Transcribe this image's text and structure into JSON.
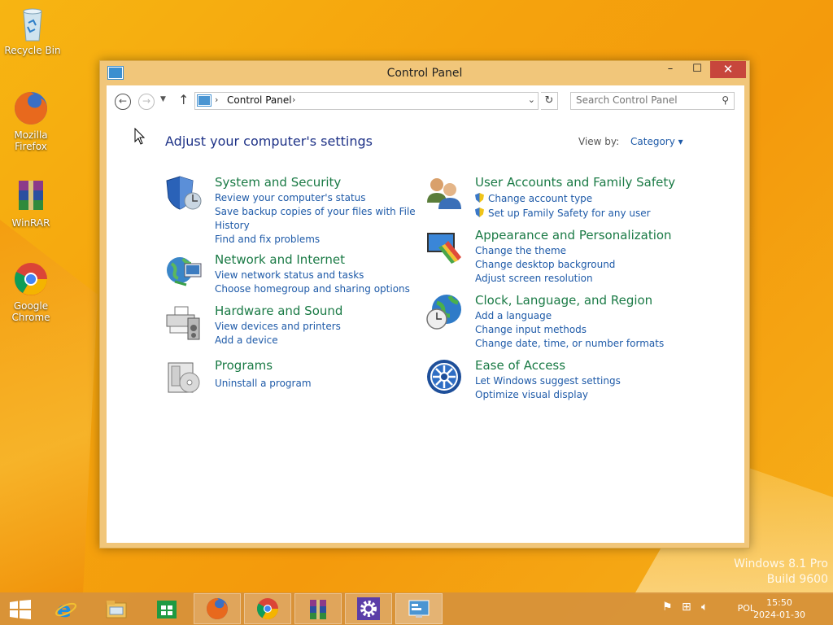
{
  "desktop": {
    "icons": [
      {
        "label": "Recycle Bin"
      },
      {
        "label": "Mozilla Firefox"
      },
      {
        "label": "WinRAR"
      },
      {
        "label": "Google Chrome"
      }
    ],
    "watermark_line1": "Windows 8.1 Pro",
    "watermark_line2": "Build 9600"
  },
  "window": {
    "title": "Control Panel",
    "controls": {
      "minimize": "–",
      "maximize": "☐",
      "close": "✕"
    }
  },
  "address": {
    "crumb": "Control Panel",
    "search_placeholder": "Search Control Panel"
  },
  "main": {
    "heading": "Adjust your computer's settings",
    "view_by_label": "View by:",
    "view_by_value": "Category ▾",
    "categories": [
      {
        "title": "System and Security",
        "links": [
          "Review your computer's status",
          "Save backup copies of your files with File",
          "History",
          "Find and fix problems"
        ]
      },
      {
        "title": "Network and Internet",
        "links": [
          "View network status and tasks",
          "Choose homegroup and sharing options"
        ]
      },
      {
        "title": "Hardware and Sound",
        "links": [
          "View devices and printers",
          "Add a device"
        ]
      },
      {
        "title": "Programs",
        "links": [
          "Uninstall a program"
        ]
      },
      {
        "title": "User Accounts and Family Safety",
        "links": [
          "Change account type",
          "Set up Family Safety for any user"
        ]
      },
      {
        "title": "Appearance and Personalization",
        "links": [
          "Change the theme",
          "Change desktop background",
          "Adjust screen resolution"
        ]
      },
      {
        "title": "Clock, Language, and Region",
        "links": [
          "Add a language",
          "Change input methods",
          "Change date, time, or number formats"
        ]
      },
      {
        "title": "Ease of Access",
        "links": [
          "Let Windows suggest settings",
          "Optimize visual display"
        ]
      }
    ]
  },
  "taskbar": {
    "language": "POL",
    "time": "15:50",
    "date": "2024-01-30"
  },
  "colors": {
    "category_title": "#1a7a45",
    "link": "#1e5aa8",
    "heading": "#1e3287",
    "close_button": "#c7463c"
  }
}
